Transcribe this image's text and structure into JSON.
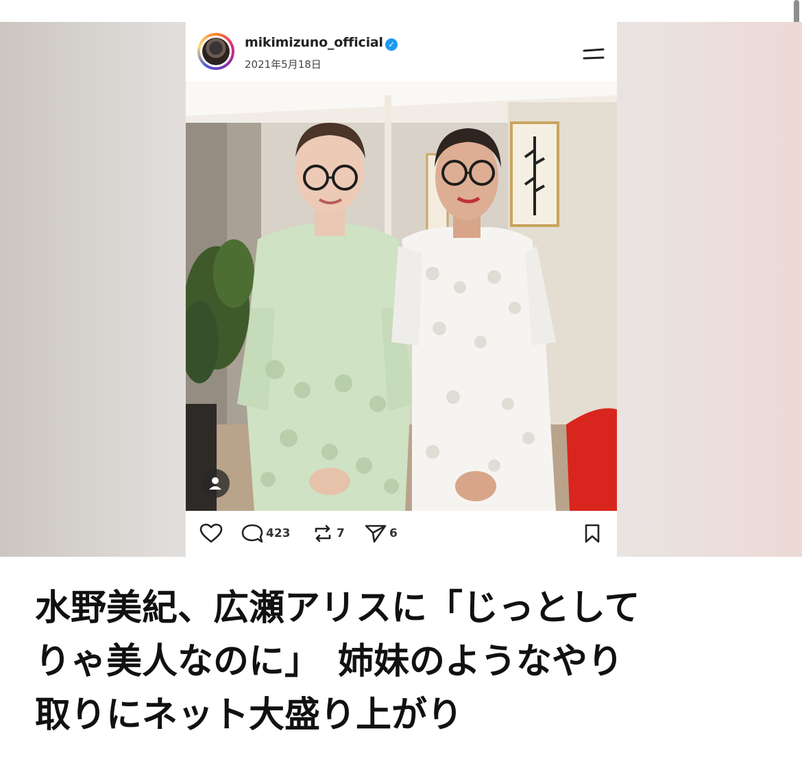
{
  "post": {
    "username": "mikimizuno_official",
    "date": "2021年5月18日",
    "comments": "423",
    "reposts": "7",
    "shares": "6"
  },
  "icons": {
    "verified": "verified-badge-icon",
    "menu": "menu-icon",
    "like": "heart-icon",
    "comment": "comment-icon",
    "repost": "repost-icon",
    "share": "send-icon",
    "save": "bookmark-icon",
    "tag": "person-tag-icon"
  },
  "colors": {
    "verified": "#1d9bf0",
    "accent": "#e01e5a"
  },
  "headline": {
    "line1": "水野美紀、広瀬アリスに「じっとして",
    "line2": "りゃ美人なのに」　姉妹のようなやり",
    "line3": "取りにネット大盛り上がり"
  }
}
